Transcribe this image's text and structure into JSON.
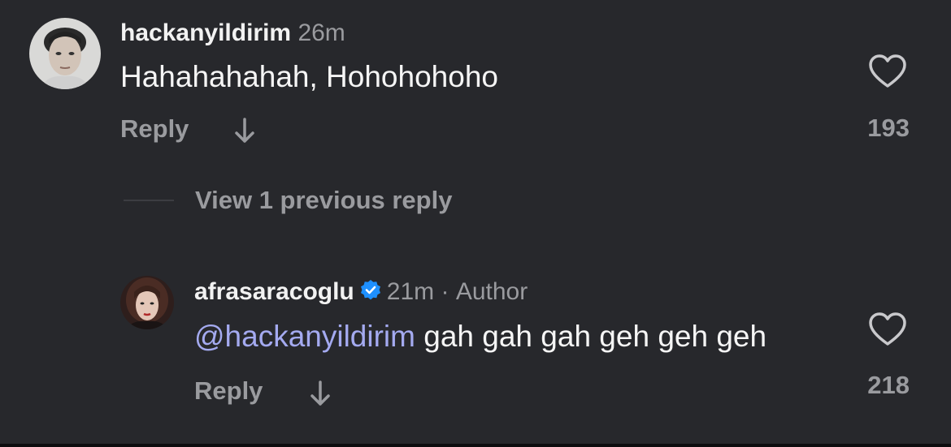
{
  "comment": {
    "username": "hackanyildirim",
    "time": "26m",
    "text": "Hahahahahah, Hohohohoho",
    "reply_label": "Reply",
    "like_count": "193"
  },
  "view_replies_label": "View 1 previous reply",
  "reply": {
    "username": "afrasaracoglu",
    "time": "21m",
    "separator": "·",
    "role": "Author",
    "mention": "@hackanyildirim",
    "text": " gah gah gah geh geh geh",
    "reply_label": "Reply",
    "like_count": "218"
  },
  "icons": {
    "like": "heart-icon",
    "translate": "arrow-down-icon",
    "verified": "verified-badge-icon"
  },
  "colors": {
    "background": "#27282c",
    "mention": "#a4aaf0",
    "verified": "#1e90ff",
    "muted_text": "#9a9b9f"
  }
}
